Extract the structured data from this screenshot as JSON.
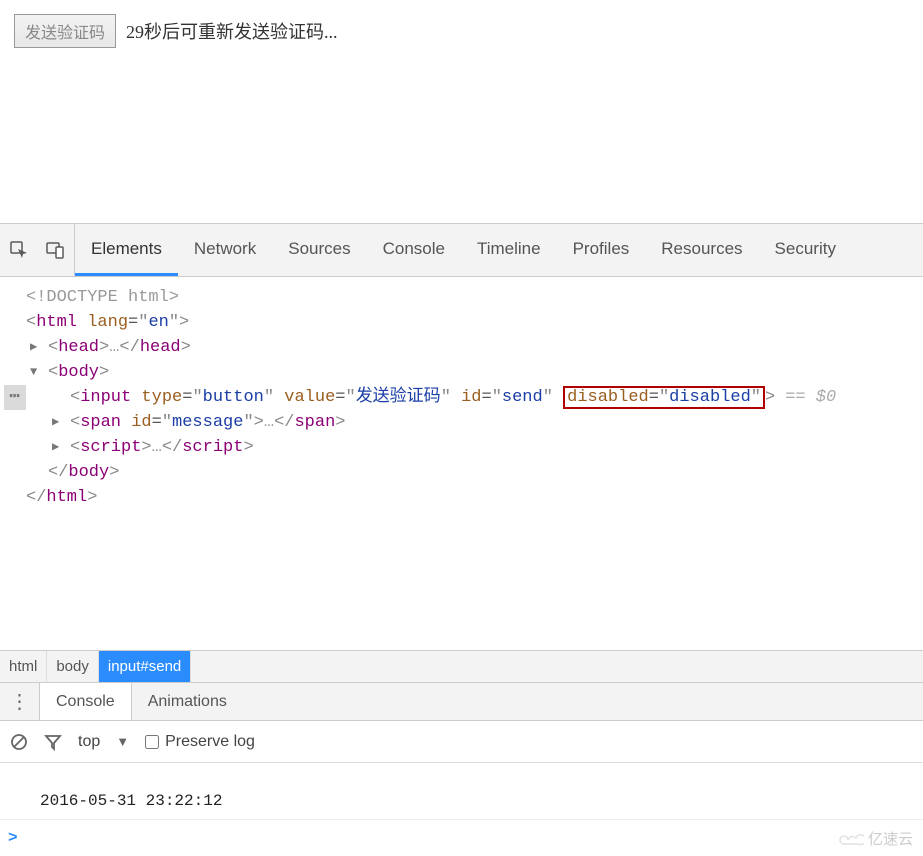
{
  "page": {
    "button_label": "发送验证码",
    "countdown_message": "29秒后可重新发送验证码..."
  },
  "devtools": {
    "tabs": [
      "Elements",
      "Network",
      "Sources",
      "Console",
      "Timeline",
      "Profiles",
      "Resources",
      "Security"
    ],
    "active_tab": "Elements"
  },
  "elements_code": {
    "doctype": "<!DOCTYPE html>",
    "html_open": {
      "tag": "html",
      "attrs": [
        {
          "name": "lang",
          "value": "en"
        }
      ]
    },
    "head_collapsed": {
      "tag": "head"
    },
    "body_open": {
      "tag": "body"
    },
    "input_line": {
      "tag": "input",
      "attrs_pre": [
        {
          "name": "type",
          "value": "button"
        },
        {
          "name": "value",
          "value": "发送验证码"
        },
        {
          "name": "id",
          "value": "send"
        }
      ],
      "highlighted_attr": {
        "name": "disabled",
        "value": "disabled"
      },
      "selection_tag": "== $0"
    },
    "span_line": {
      "tag": "span",
      "attrs": [
        {
          "name": "id",
          "value": "message"
        }
      ]
    },
    "script_line": {
      "tag": "script"
    },
    "body_close": "body",
    "html_close": "html"
  },
  "breadcrumb": [
    "html",
    "body",
    "input#send"
  ],
  "drawer": {
    "tabs": [
      "Console",
      "Animations"
    ],
    "active_tab": "Console"
  },
  "console_toolbar": {
    "context": "top",
    "preserve_label": "Preserve log"
  },
  "console": {
    "log_time": "2016-05-31 23:22:12",
    "prompt": ">"
  },
  "watermark": "亿速云"
}
